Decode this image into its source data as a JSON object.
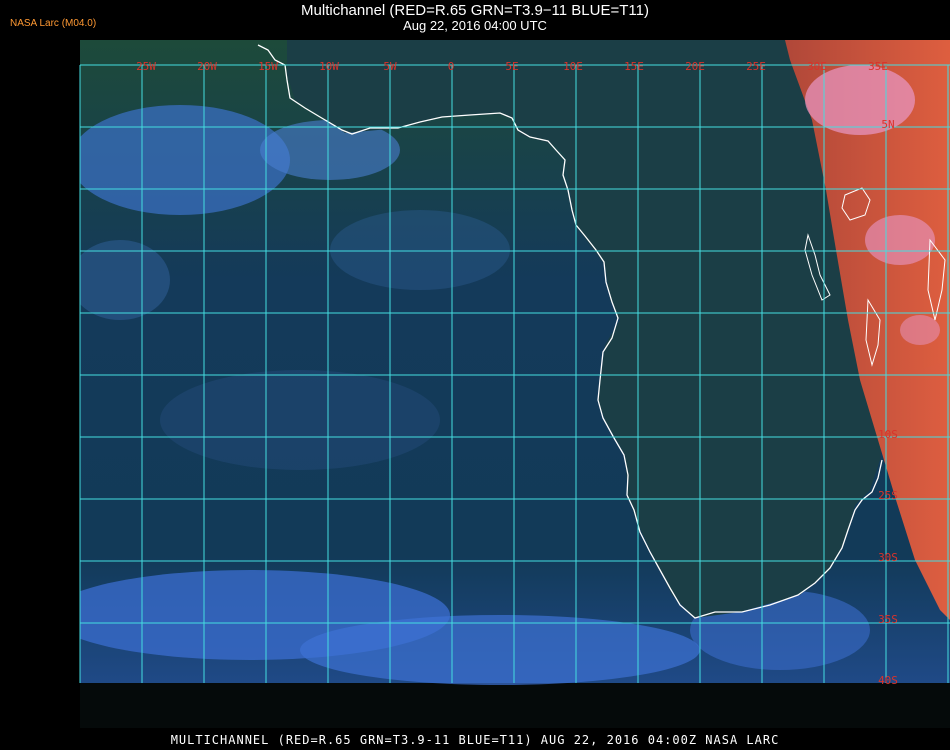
{
  "header": {
    "title": "Multichannel (RED=R.65 GRN=T3.9−11 BLUE=T11)",
    "subtitle": "Aug 22, 2016 04:00 UTC",
    "agency": "NASA Larc (M04.0)"
  },
  "footer": {
    "caption": "MULTICHANNEL (RED=R.65 GRN=T3.9-11 BLUE=T11) AUG 22, 2016 04:00Z   NASA LARC"
  },
  "map": {
    "lon_labels": [
      "25W",
      "20W",
      "15W",
      "10W",
      "5W",
      "0",
      "5E",
      "10E",
      "15E",
      "20E",
      "25E",
      "30E",
      "35E"
    ],
    "lat_labels": [
      "5N",
      "10S",
      "25S",
      "30S",
      "35S",
      "40S"
    ],
    "colors": {
      "grid": "#44dde0",
      "coast": "#ffffff",
      "label": "#d9332b",
      "ocean": "#123a55",
      "cloud": "#3f77c8",
      "land_hot": "#d8523e"
    }
  }
}
